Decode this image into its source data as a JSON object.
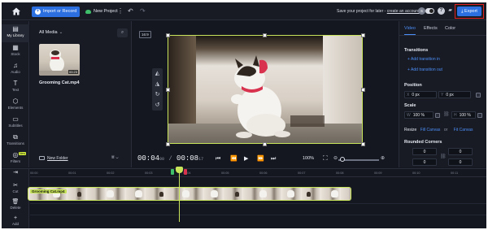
{
  "topbar": {
    "import_label": "Import or Record",
    "new_project_label": "New Project",
    "save_message": "Save your project for later -",
    "save_link": "create an account",
    "avatar_initial": "S",
    "export_label": "Export",
    "accent_color": "#2b6fe0",
    "highlight_color": "#e0201f"
  },
  "rail": {
    "items": [
      {
        "label": "My Library",
        "icon": "library-icon",
        "glyph": "▤"
      },
      {
        "label": "Stock",
        "icon": "stock-icon",
        "glyph": "▦"
      },
      {
        "label": "Audio",
        "icon": "music-note-icon",
        "glyph": "♫"
      },
      {
        "label": "Text",
        "icon": "text-icon",
        "glyph": "T"
      },
      {
        "label": "Elements",
        "icon": "elements-icon",
        "glyph": "⬡"
      },
      {
        "label": "Subtitles",
        "icon": "subtitles-icon",
        "glyph": "▭"
      },
      {
        "label": "Transitions",
        "icon": "transitions-icon",
        "glyph": "⧉"
      },
      {
        "label": "Filters",
        "icon": "filters-icon",
        "glyph": "◎"
      }
    ],
    "new_badge": "New"
  },
  "library": {
    "filter_label": "All Media",
    "thumb_duration": "00:23",
    "thumb_name": "Grooming Cat.mp4",
    "new_folder_label": "New Folder"
  },
  "stage": {
    "aspect_ratio": "16:9",
    "timecode_current": "00:04",
    "timecode_frames_current": "00",
    "timecode_total": "00:08",
    "timecode_frames_total": "17",
    "zoom_percent": "100%"
  },
  "props": {
    "tabs": [
      "Video",
      "Effects",
      "Color"
    ],
    "transitions_title": "Transitions",
    "add_transition_in": "+ Add transition in",
    "add_transition_out": "+ Add transition out",
    "position_title": "Position",
    "x_label": "X",
    "x_value": "0 px",
    "y_label": "Y",
    "y_value": "0 px",
    "scale_title": "Scale",
    "w_label": "W",
    "w_value": "100 %",
    "h_label": "H",
    "h_value": "100 %",
    "resize_label": "Resize",
    "fill_canvas": "Fill Canvas",
    "or_label": "or",
    "fit_canvas": "Fit Canvas",
    "rounded_title": "Rounded Corners",
    "corner_values": [
      "0",
      "0",
      "0",
      "0"
    ]
  },
  "timeline": {
    "tools": [
      {
        "label": "Cut",
        "icon": "scissors-icon",
        "glyph": "✂"
      },
      {
        "label": "Delete",
        "icon": "trash-icon",
        "glyph": "🗑"
      },
      {
        "label": "Add",
        "icon": "add-icon",
        "glyph": "+"
      }
    ],
    "ruler_ticks": [
      "00:00",
      "00:01",
      "00:02",
      "00:03",
      "00:04",
      "00:05",
      "00:06",
      "00:07",
      "00:08",
      "00:09",
      "00:10",
      "00:11"
    ],
    "clip_name": "Grooming Cat.mp4",
    "clip_color": "#c8e45a"
  }
}
